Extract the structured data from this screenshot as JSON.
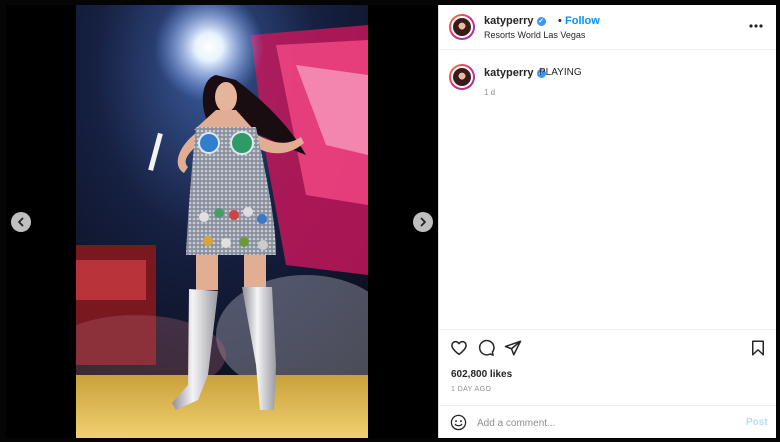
{
  "post": {
    "username": "katyperry",
    "follow_label": "Follow",
    "separator": "•",
    "location": "Resorts World Las Vegas",
    "caption_text": "PLAYING",
    "caption_time": "1 d",
    "likes": "602,800 likes",
    "posted_ago": "1 DAY AGO"
  },
  "comment": {
    "placeholder": "Add a comment...",
    "post_label": "Post"
  },
  "icons": {
    "prev": "chevron-left-icon",
    "next": "chevron-right-icon",
    "more": "more-options-icon",
    "like": "heart-icon",
    "comment": "comment-icon",
    "share": "paper-plane-icon",
    "save": "bookmark-icon",
    "emoji": "emoji-icon",
    "verified": "verified-badge-icon"
  },
  "colors": {
    "accent": "#0095f6",
    "verified": "#3897f0",
    "post_disabled": "#b2dffc"
  }
}
